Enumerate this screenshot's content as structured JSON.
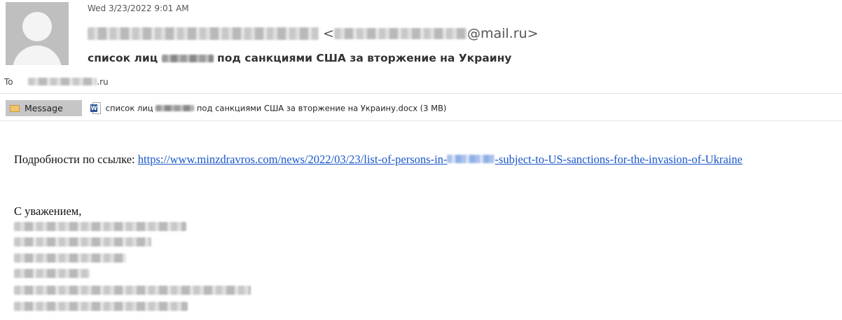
{
  "header": {
    "date": "Wed 3/23/2022 9:01 AM",
    "from_open": "<",
    "from_domain": "@mail.ru>",
    "subject_prefix": "список лиц",
    "subject_suffix": "под санкциями США за вторжение на Украину",
    "to_label": "To",
    "to_domain": ".ru"
  },
  "tabs": {
    "message_label": "Message"
  },
  "attachment": {
    "name_prefix": "список лиц",
    "name_suffix": "под санкциями США за вторжение на Украину.docx (3 MB)",
    "icon": "word-doc-icon"
  },
  "body": {
    "details_label": "Подробности по ссылке:",
    "link_start": "https://www.minzdravros.com/news/2022/03/23/list-of-persons-in-",
    "link_end": "-subject-to-US-sanctions-for-the-invasion-of-Ukraine",
    "regards": "С уважением,"
  },
  "colors": {
    "link": "#1a57c8",
    "tab_bg": "#c6c6c6",
    "avatar_bg": "#bfbfbf"
  }
}
